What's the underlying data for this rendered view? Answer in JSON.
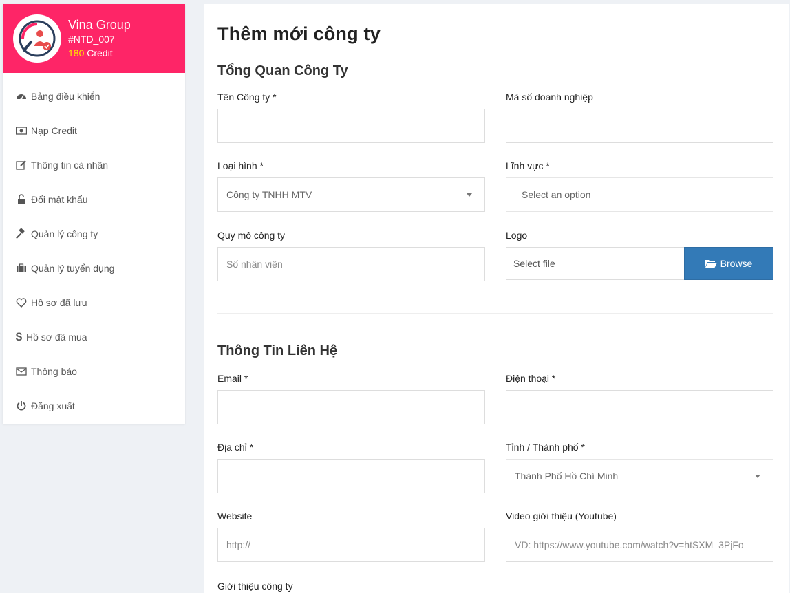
{
  "profile": {
    "name": "Vina Group",
    "code": "#NTD_007",
    "credit_amount": "180",
    "credit_label": "Credit"
  },
  "sidebar": {
    "items": [
      {
        "label": "Bảng điều khiển",
        "icon": "dashboard-icon"
      },
      {
        "label": "Nạp Credit",
        "icon": "money-icon"
      },
      {
        "label": "Thông tin cá nhân",
        "icon": "edit-icon"
      },
      {
        "label": "Đổi mật khẩu",
        "icon": "unlock-icon"
      },
      {
        "label": "Quản lý công ty",
        "icon": "gavel-icon"
      },
      {
        "label": "Quản lý tuyển dụng",
        "icon": "briefcase-icon"
      },
      {
        "label": "Hồ sơ đã lưu",
        "icon": "heart-icon"
      },
      {
        "label": "Hồ sơ đã mua",
        "icon": "dollar-icon"
      },
      {
        "label": "Thông báo",
        "icon": "envelope-icon"
      },
      {
        "label": "Đăng xuất",
        "icon": "power-icon"
      }
    ]
  },
  "main": {
    "title": "Thêm mới công ty",
    "section_overview": "Tổng Quan Công Ty",
    "section_contact": "Thông Tin Liên Hệ",
    "fields": {
      "company_name": {
        "label": "Tên Công ty *",
        "value": ""
      },
      "business_code": {
        "label": "Mã số doanh nghiệp",
        "value": ""
      },
      "company_type": {
        "label": "Loại hình *",
        "selected": "Công ty TNHH MTV"
      },
      "industry": {
        "label": "Lĩnh vực *",
        "placeholder": "Select an option"
      },
      "company_size": {
        "label": "Quy mô công ty",
        "placeholder": "Số nhân viên"
      },
      "logo": {
        "label": "Logo",
        "file_text": "Select file",
        "browse_label": "Browse"
      },
      "email": {
        "label": "Email *",
        "value": ""
      },
      "phone": {
        "label": "Điện thoại *",
        "value": ""
      },
      "address": {
        "label": "Địa chỉ *",
        "value": ""
      },
      "city": {
        "label": "Tỉnh / Thành phố *",
        "selected": "Thành Phố Hồ Chí Minh"
      },
      "website": {
        "label": "Website",
        "placeholder": "http://"
      },
      "video": {
        "label": "Video giới thiệu (Youtube)",
        "placeholder": "VD: https://www.youtube.com/watch?v=htSXM_3PjFo"
      },
      "intro": {
        "label": "Giới thiệu công ty"
      }
    }
  },
  "colors": {
    "brand_pink": "#fe2567",
    "credit_yellow": "#ffe400",
    "browse_blue": "#337ab7"
  }
}
